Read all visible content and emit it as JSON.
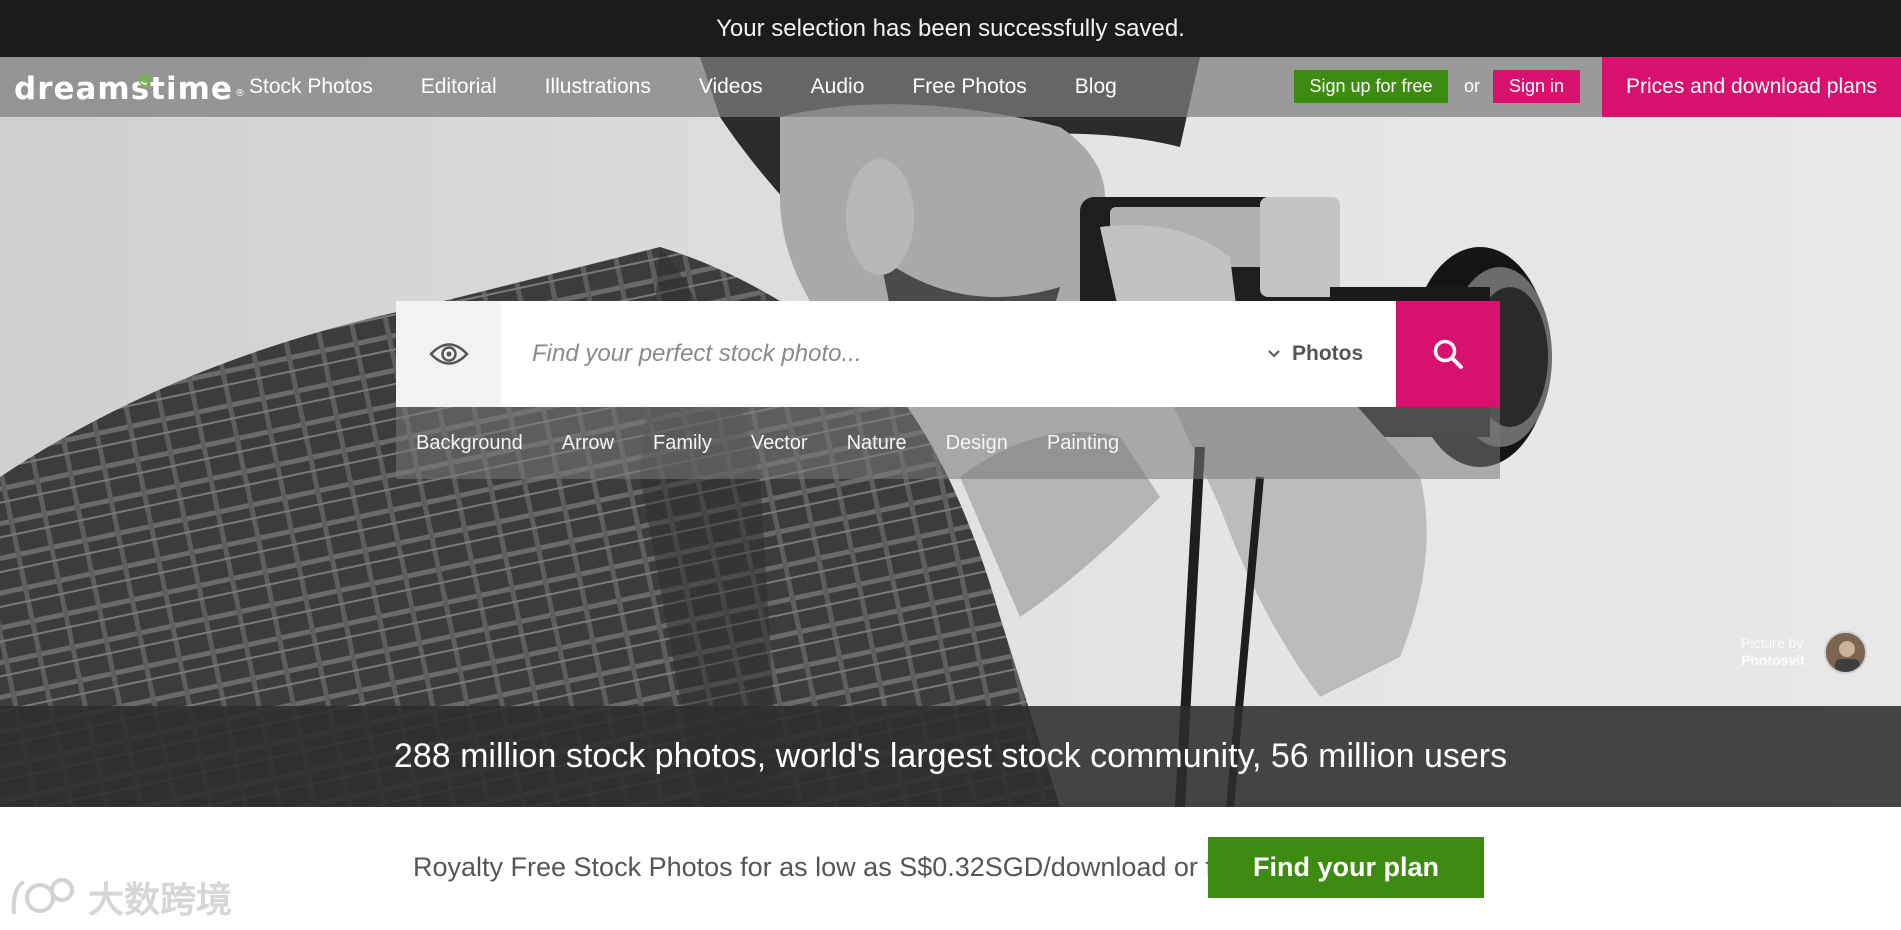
{
  "notice": {
    "text": "Your selection has been successfully saved."
  },
  "header": {
    "logo_text": "dreamstime",
    "logo_reg": "®",
    "nav": [
      "Stock Photos",
      "Editorial",
      "Illustrations",
      "Videos",
      "Audio",
      "Free Photos",
      "Blog"
    ],
    "signup_label": "Sign up for free",
    "or_text": "or",
    "signin_label": "Sign in",
    "prices_label": "Prices and download plans"
  },
  "search": {
    "placeholder": "Find your perfect stock photo...",
    "type_label": "Photos",
    "tags": [
      "Background",
      "Arrow",
      "Family",
      "Vector",
      "Nature",
      "Design",
      "Painting"
    ]
  },
  "credit": {
    "line1": "Picture by",
    "author": "Photosvit"
  },
  "stats": {
    "text": "288 million stock photos, world's largest stock community, 56 million users"
  },
  "promo": {
    "text": "Royalty Free Stock Photos for as low as S$0.32SGD/download or free",
    "button_label": "Find your plan"
  },
  "watermark": {
    "text": "大数跨境"
  },
  "colors": {
    "brand_pink": "#d8116f",
    "brand_green": "#3d8b10",
    "notice_bg": "#1b1b1b"
  },
  "icons": [
    "eye-icon",
    "chevron-down-icon",
    "search-icon",
    "logo-swirl-icon"
  ]
}
